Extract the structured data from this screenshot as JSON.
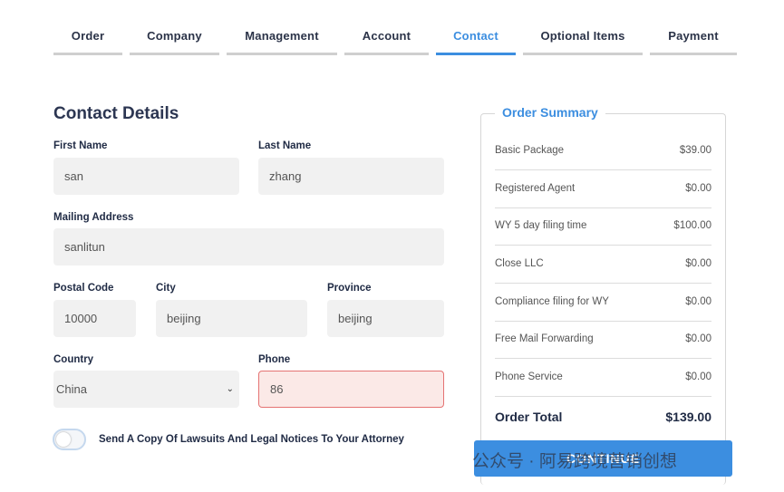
{
  "tabs": [
    {
      "label": "Order"
    },
    {
      "label": "Company"
    },
    {
      "label": "Management"
    },
    {
      "label": "Account"
    },
    {
      "label": "Contact"
    },
    {
      "label": "Optional Items"
    },
    {
      "label": "Payment"
    }
  ],
  "active_tab": "Contact",
  "form": {
    "title": "Contact Details",
    "first_name": {
      "label": "First Name",
      "value": "san"
    },
    "last_name": {
      "label": "Last Name",
      "value": "zhang"
    },
    "mailing_address": {
      "label": "Mailing Address",
      "value": "sanlitun"
    },
    "postal_code": {
      "label": "Postal Code",
      "value": "10000"
    },
    "city": {
      "label": "City",
      "value": "beijing"
    },
    "province": {
      "label": "Province",
      "value": "beijing"
    },
    "country": {
      "label": "Country",
      "value": "China",
      "chevron": "⌄"
    },
    "phone": {
      "label": "Phone",
      "value": "86"
    },
    "attorney_toggle": {
      "label": "Send A Copy Of Lawsuits And Legal Notices To Your Attorney",
      "on": false
    }
  },
  "summary": {
    "title": "Order Summary",
    "rows": [
      {
        "name": "Basic Package",
        "value": "$39.00"
      },
      {
        "name": "Registered Agent",
        "value": "$0.00"
      },
      {
        "name": "WY 5 day filing time",
        "value": "$100.00"
      },
      {
        "name": "Close LLC",
        "value": "$0.00"
      },
      {
        "name": "Compliance filing for WY",
        "value": "$0.00"
      },
      {
        "name": "Free Mail Forwarding",
        "value": "$0.00"
      },
      {
        "name": "Phone Service",
        "value": "$0.00"
      }
    ],
    "total": {
      "name": "Order Total",
      "value": "$139.00"
    }
  },
  "continue_label": "CONTINUE",
  "watermark": "公众号 · 阿易跨境营销创想",
  "colors": {
    "accent": "#3c8ee0",
    "error_bg": "#fbe9e7",
    "error_border": "#e57373"
  }
}
